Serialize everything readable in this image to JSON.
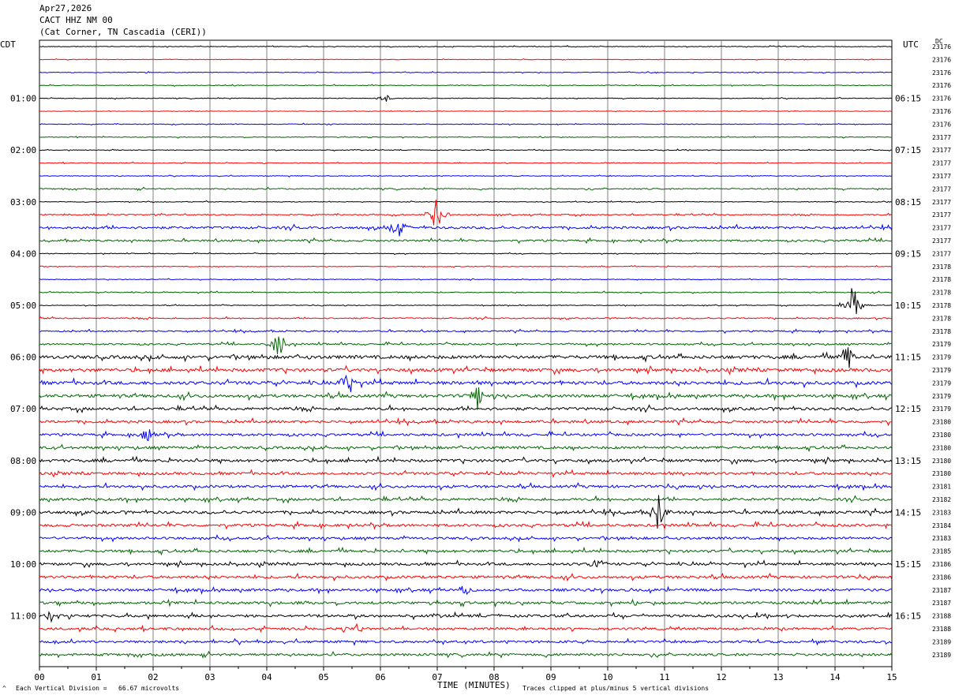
{
  "header": {
    "date": "Apr27,2026",
    "channel": "CACT HHZ NM 00",
    "station": "(Cat Corner, TN Cascadia (CERI))"
  },
  "left_tz": "CDT",
  "right_tz": "UTC",
  "dc_label": "DC",
  "footer": {
    "scale_note": "Each Vertical Division =   66.67 microvolts",
    "clip_note": "Traces clipped at plus/minus 5 vertical divisions",
    "corner_mark": "^"
  },
  "colors": {
    "trace_cycle": [
      "#000000",
      "#ff0000",
      "#0000ff",
      "#006600"
    ],
    "grid": "#808080"
  },
  "chart_data": {
    "type": "line",
    "title": "",
    "xlabel": "TIME (MINUTES)",
    "x_ticks": [
      "00",
      "01",
      "02",
      "03",
      "04",
      "05",
      "06",
      "07",
      "08",
      "09",
      "10",
      "11",
      "12",
      "13",
      "14",
      "15"
    ],
    "xlim": [
      0,
      15
    ],
    "rows": 48,
    "minutes_per_row": 15,
    "left_hour_labels": [
      {
        "row": 4,
        "label": "01:00"
      },
      {
        "row": 8,
        "label": "02:00"
      },
      {
        "row": 12,
        "label": "03:00"
      },
      {
        "row": 16,
        "label": "04:00"
      },
      {
        "row": 20,
        "label": "05:00"
      },
      {
        "row": 24,
        "label": "06:00"
      },
      {
        "row": 28,
        "label": "07:00"
      },
      {
        "row": 32,
        "label": "08:00"
      },
      {
        "row": 36,
        "label": "09:00"
      },
      {
        "row": 40,
        "label": "10:00"
      },
      {
        "row": 44,
        "label": "11:00"
      }
    ],
    "right_hour_labels": [
      {
        "row": 4,
        "label": "06:15"
      },
      {
        "row": 8,
        "label": "07:15"
      },
      {
        "row": 12,
        "label": "08:15"
      },
      {
        "row": 16,
        "label": "09:15"
      },
      {
        "row": 20,
        "label": "10:15"
      },
      {
        "row": 24,
        "label": "11:15"
      },
      {
        "row": 28,
        "label": "12:15"
      },
      {
        "row": 32,
        "label": "13:15"
      },
      {
        "row": 36,
        "label": "14:15"
      },
      {
        "row": 40,
        "label": "15:15"
      },
      {
        "row": 44,
        "label": "16:15"
      }
    ],
    "dc_offsets": [
      "23176",
      "23176",
      "23176",
      "23176",
      "23176",
      "23176",
      "23176",
      "23177",
      "23177",
      "23177",
      "23177",
      "23177",
      "23177",
      "23177",
      "23177",
      "23177",
      "23177",
      "23178",
      "23178",
      "23178",
      "23178",
      "23178",
      "23178",
      "23179",
      "23179",
      "23179",
      "23179",
      "23179",
      "23179",
      "23180",
      "23180",
      "23180",
      "23180",
      "23180",
      "23181",
      "23182",
      "23183",
      "23184",
      "23183",
      "23185",
      "23186",
      "23186",
      "23187",
      "23187",
      "23188",
      "23188",
      "23189",
      "23189"
    ],
    "row_activity": [
      0.3,
      0.2,
      0.3,
      0.3,
      0.3,
      0.2,
      0.3,
      0.3,
      0.3,
      0.3,
      0.3,
      0.5,
      0.3,
      0.5,
      1.0,
      0.8,
      0.3,
      0.3,
      0.3,
      0.4,
      0.3,
      0.5,
      0.6,
      0.7,
      1.4,
      1.4,
      1.4,
      1.3,
      1.2,
      1.1,
      1.0,
      1.1,
      1.2,
      1.1,
      1.1,
      1.1,
      1.2,
      1.1,
      1.0,
      1.1,
      1.1,
      1.1,
      1.1,
      1.1,
      1.1,
      1.0,
      1.0,
      1.0
    ],
    "events": [
      {
        "row": 4,
        "minute": 6.1,
        "amp": 6
      },
      {
        "row": 13,
        "minute": 7.0,
        "amp": 28
      },
      {
        "row": 14,
        "minute": 6.3,
        "amp": 18
      },
      {
        "row": 20,
        "minute": 14.3,
        "amp": 40
      },
      {
        "row": 23,
        "minute": 4.2,
        "amp": 22
      },
      {
        "row": 24,
        "minute": 14.2,
        "amp": 22
      },
      {
        "row": 26,
        "minute": 5.4,
        "amp": 18
      },
      {
        "row": 27,
        "minute": 7.7,
        "amp": 20
      },
      {
        "row": 30,
        "minute": 1.9,
        "amp": 10
      },
      {
        "row": 36,
        "minute": 10.9,
        "amp": 30
      },
      {
        "row": 40,
        "minute": 9.8,
        "amp": 10
      },
      {
        "row": 42,
        "minute": 7.5,
        "amp": 8
      },
      {
        "row": 44,
        "minute": 0.2,
        "amp": 10
      },
      {
        "row": 45,
        "minute": 5.6,
        "amp": 8
      }
    ]
  }
}
